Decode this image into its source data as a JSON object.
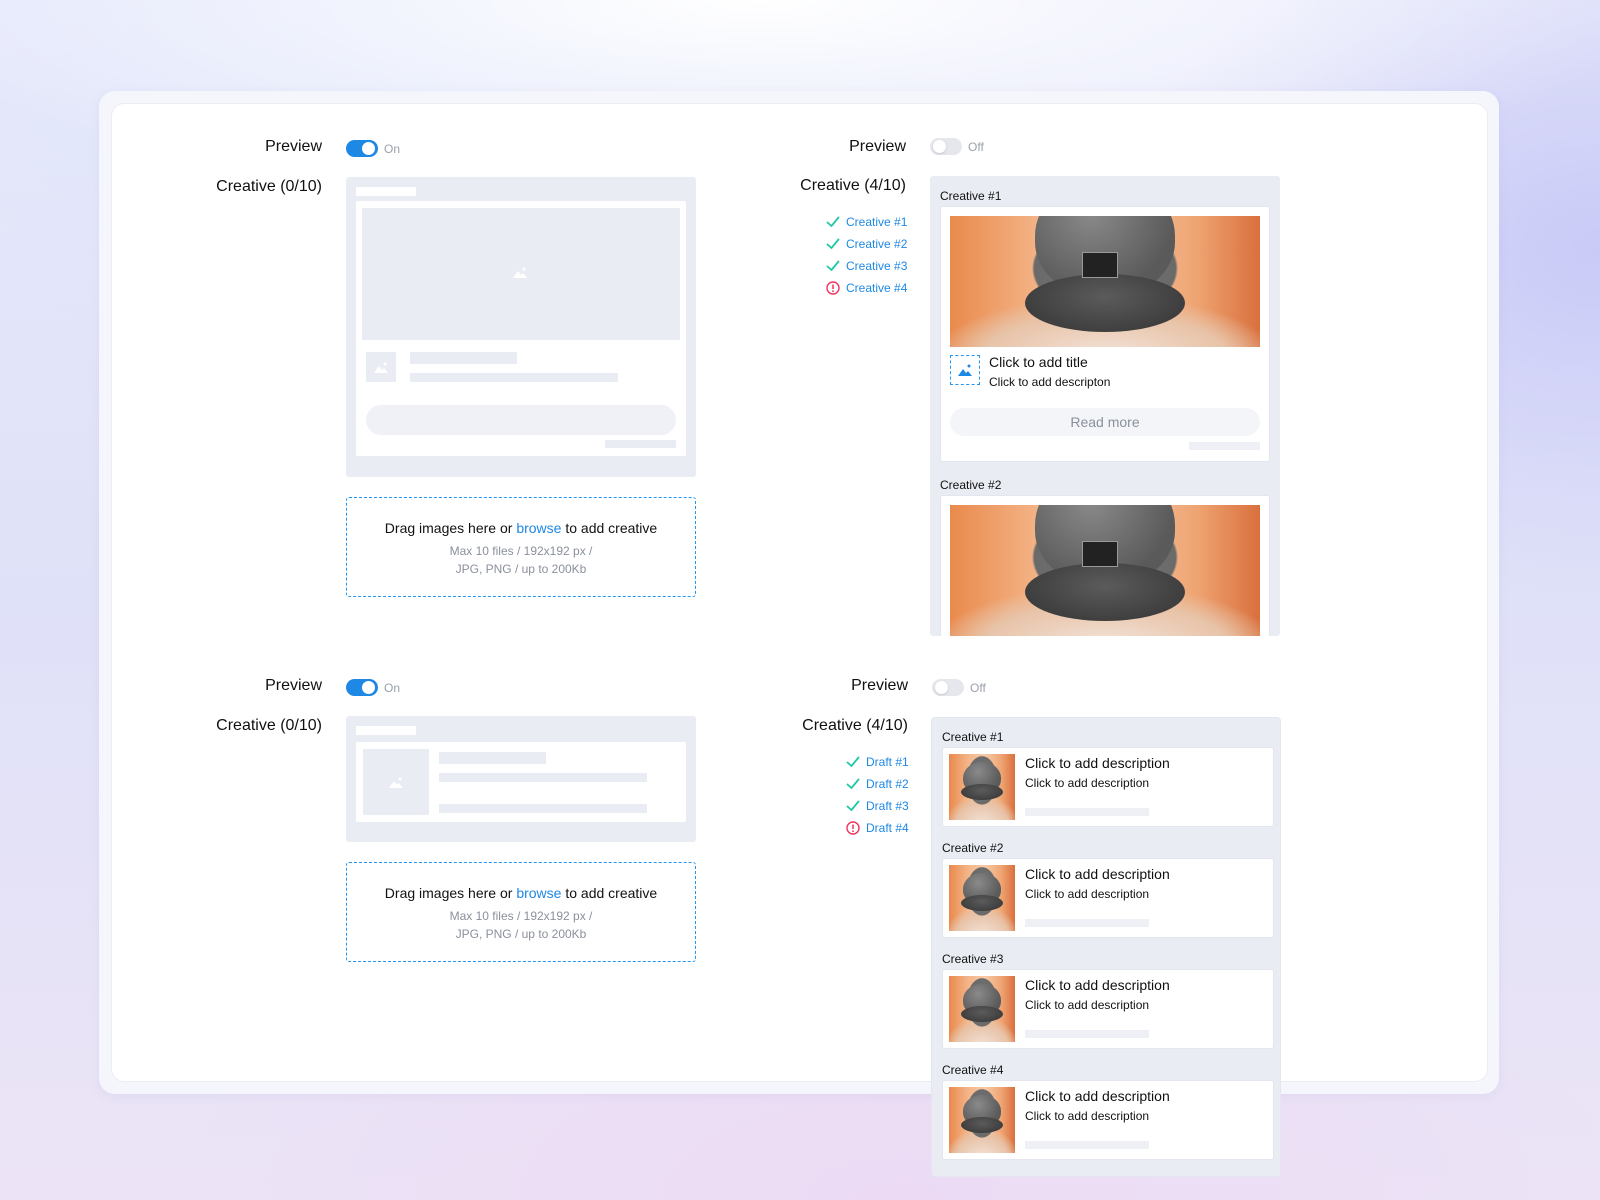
{
  "colors": {
    "accent": "#1e88e5",
    "success": "#1ec8a5",
    "error": "#f0335b",
    "skeleton": "#e9ecf3"
  },
  "sections": [
    {
      "preview_label": "Preview",
      "toggle_state": "On",
      "creative_label": "Creative (0/10)",
      "dropzone": {
        "text_before": "Drag images here or ",
        "link": "browse",
        "text_after": " to add creative",
        "line1": "Max 10 files / 192x192 px /",
        "line2": "JPG, PNG / up to 200Kb"
      }
    },
    {
      "preview_label": "Preview",
      "toggle_state": "Off",
      "creative_label": "Creative (4/10)",
      "statuses": [
        {
          "label": "Creative #1",
          "status": "ok"
        },
        {
          "label": "Creative #2",
          "status": "ok"
        },
        {
          "label": "Creative #3",
          "status": "ok"
        },
        {
          "label": "Creative #4",
          "status": "error"
        }
      ],
      "cards": [
        {
          "caption": "Creative #1",
          "title": "Click to add title",
          "description": "Click to add descripton",
          "button": "Read more"
        },
        {
          "caption": "Creative #2"
        }
      ]
    },
    {
      "preview_label": "Preview",
      "toggle_state": "On",
      "creative_label": "Creative (0/10)",
      "dropzone": {
        "text_before": "Drag images here or ",
        "link": "browse",
        "text_after": " to add creative",
        "line1": "Max 10 files / 192x192 px /",
        "line2": "JPG, PNG / up to 200Kb"
      }
    },
    {
      "preview_label": "Preview",
      "toggle_state": "Off",
      "creative_label": "Creative (4/10)",
      "statuses": [
        {
          "label": "Draft #1",
          "status": "ok"
        },
        {
          "label": "Draft #2",
          "status": "ok"
        },
        {
          "label": "Draft #3",
          "status": "ok"
        },
        {
          "label": "Draft #4",
          "status": "error"
        }
      ],
      "cards": [
        {
          "caption": "Creative #1",
          "title": "Click to add description",
          "description": "Click to add description"
        },
        {
          "caption": "Creative #2",
          "title": "Click to add description",
          "description": "Click to add description"
        },
        {
          "caption": "Creative #3",
          "title": "Click to add description",
          "description": "Click to add description"
        },
        {
          "caption": "Creative #4",
          "title": "Click to add description",
          "description": "Click to add description"
        }
      ]
    }
  ]
}
